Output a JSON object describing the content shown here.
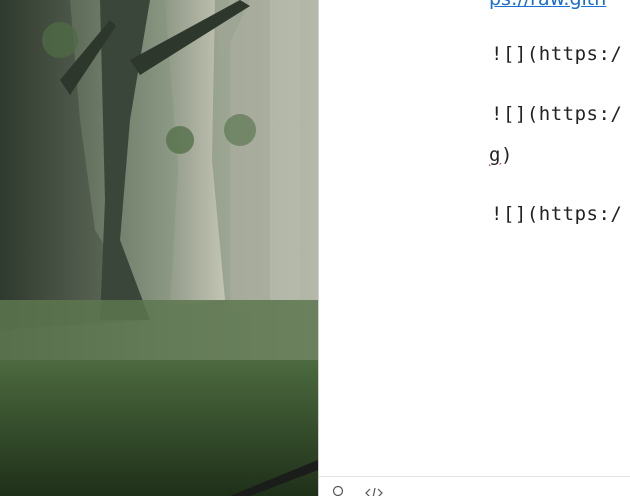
{
  "editor": {
    "top_link_text": "ps://raw.gith",
    "lines": [
      {
        "text": "![](https:/"
      },
      {
        "text": "![](https:/"
      },
      {
        "continuation_prefix": "g",
        "continuation_suffix": ")"
      },
      {
        "text": "![](https:/"
      }
    ]
  },
  "statusbar": {
    "icons": [
      "search-icon",
      "code-icon"
    ]
  },
  "colors": {
    "link": "#1a6fd0",
    "text": "#222222",
    "spell_error": "#d11b1b"
  }
}
